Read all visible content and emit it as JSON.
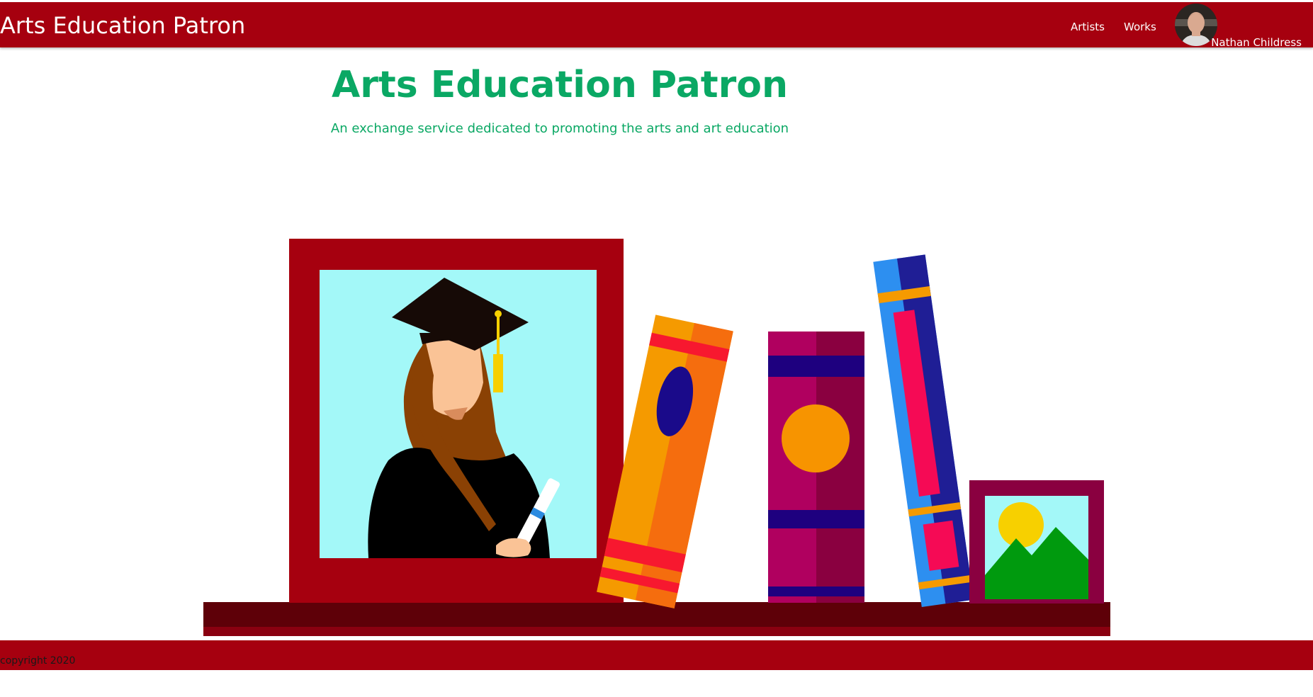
{
  "header": {
    "brand": "Arts Education Patron",
    "nav": {
      "artists": "Artists",
      "works": "Works"
    },
    "user": {
      "name": "Nathan Childress"
    }
  },
  "hero": {
    "title": "Arts Education Patron",
    "subtitle": "An exchange service dedicated to promoting the arts and art education"
  },
  "footer": {
    "copyright": "copyright 2020"
  },
  "colors": {
    "brand_red": "#a6000f",
    "accent_green": "#0aa864"
  }
}
